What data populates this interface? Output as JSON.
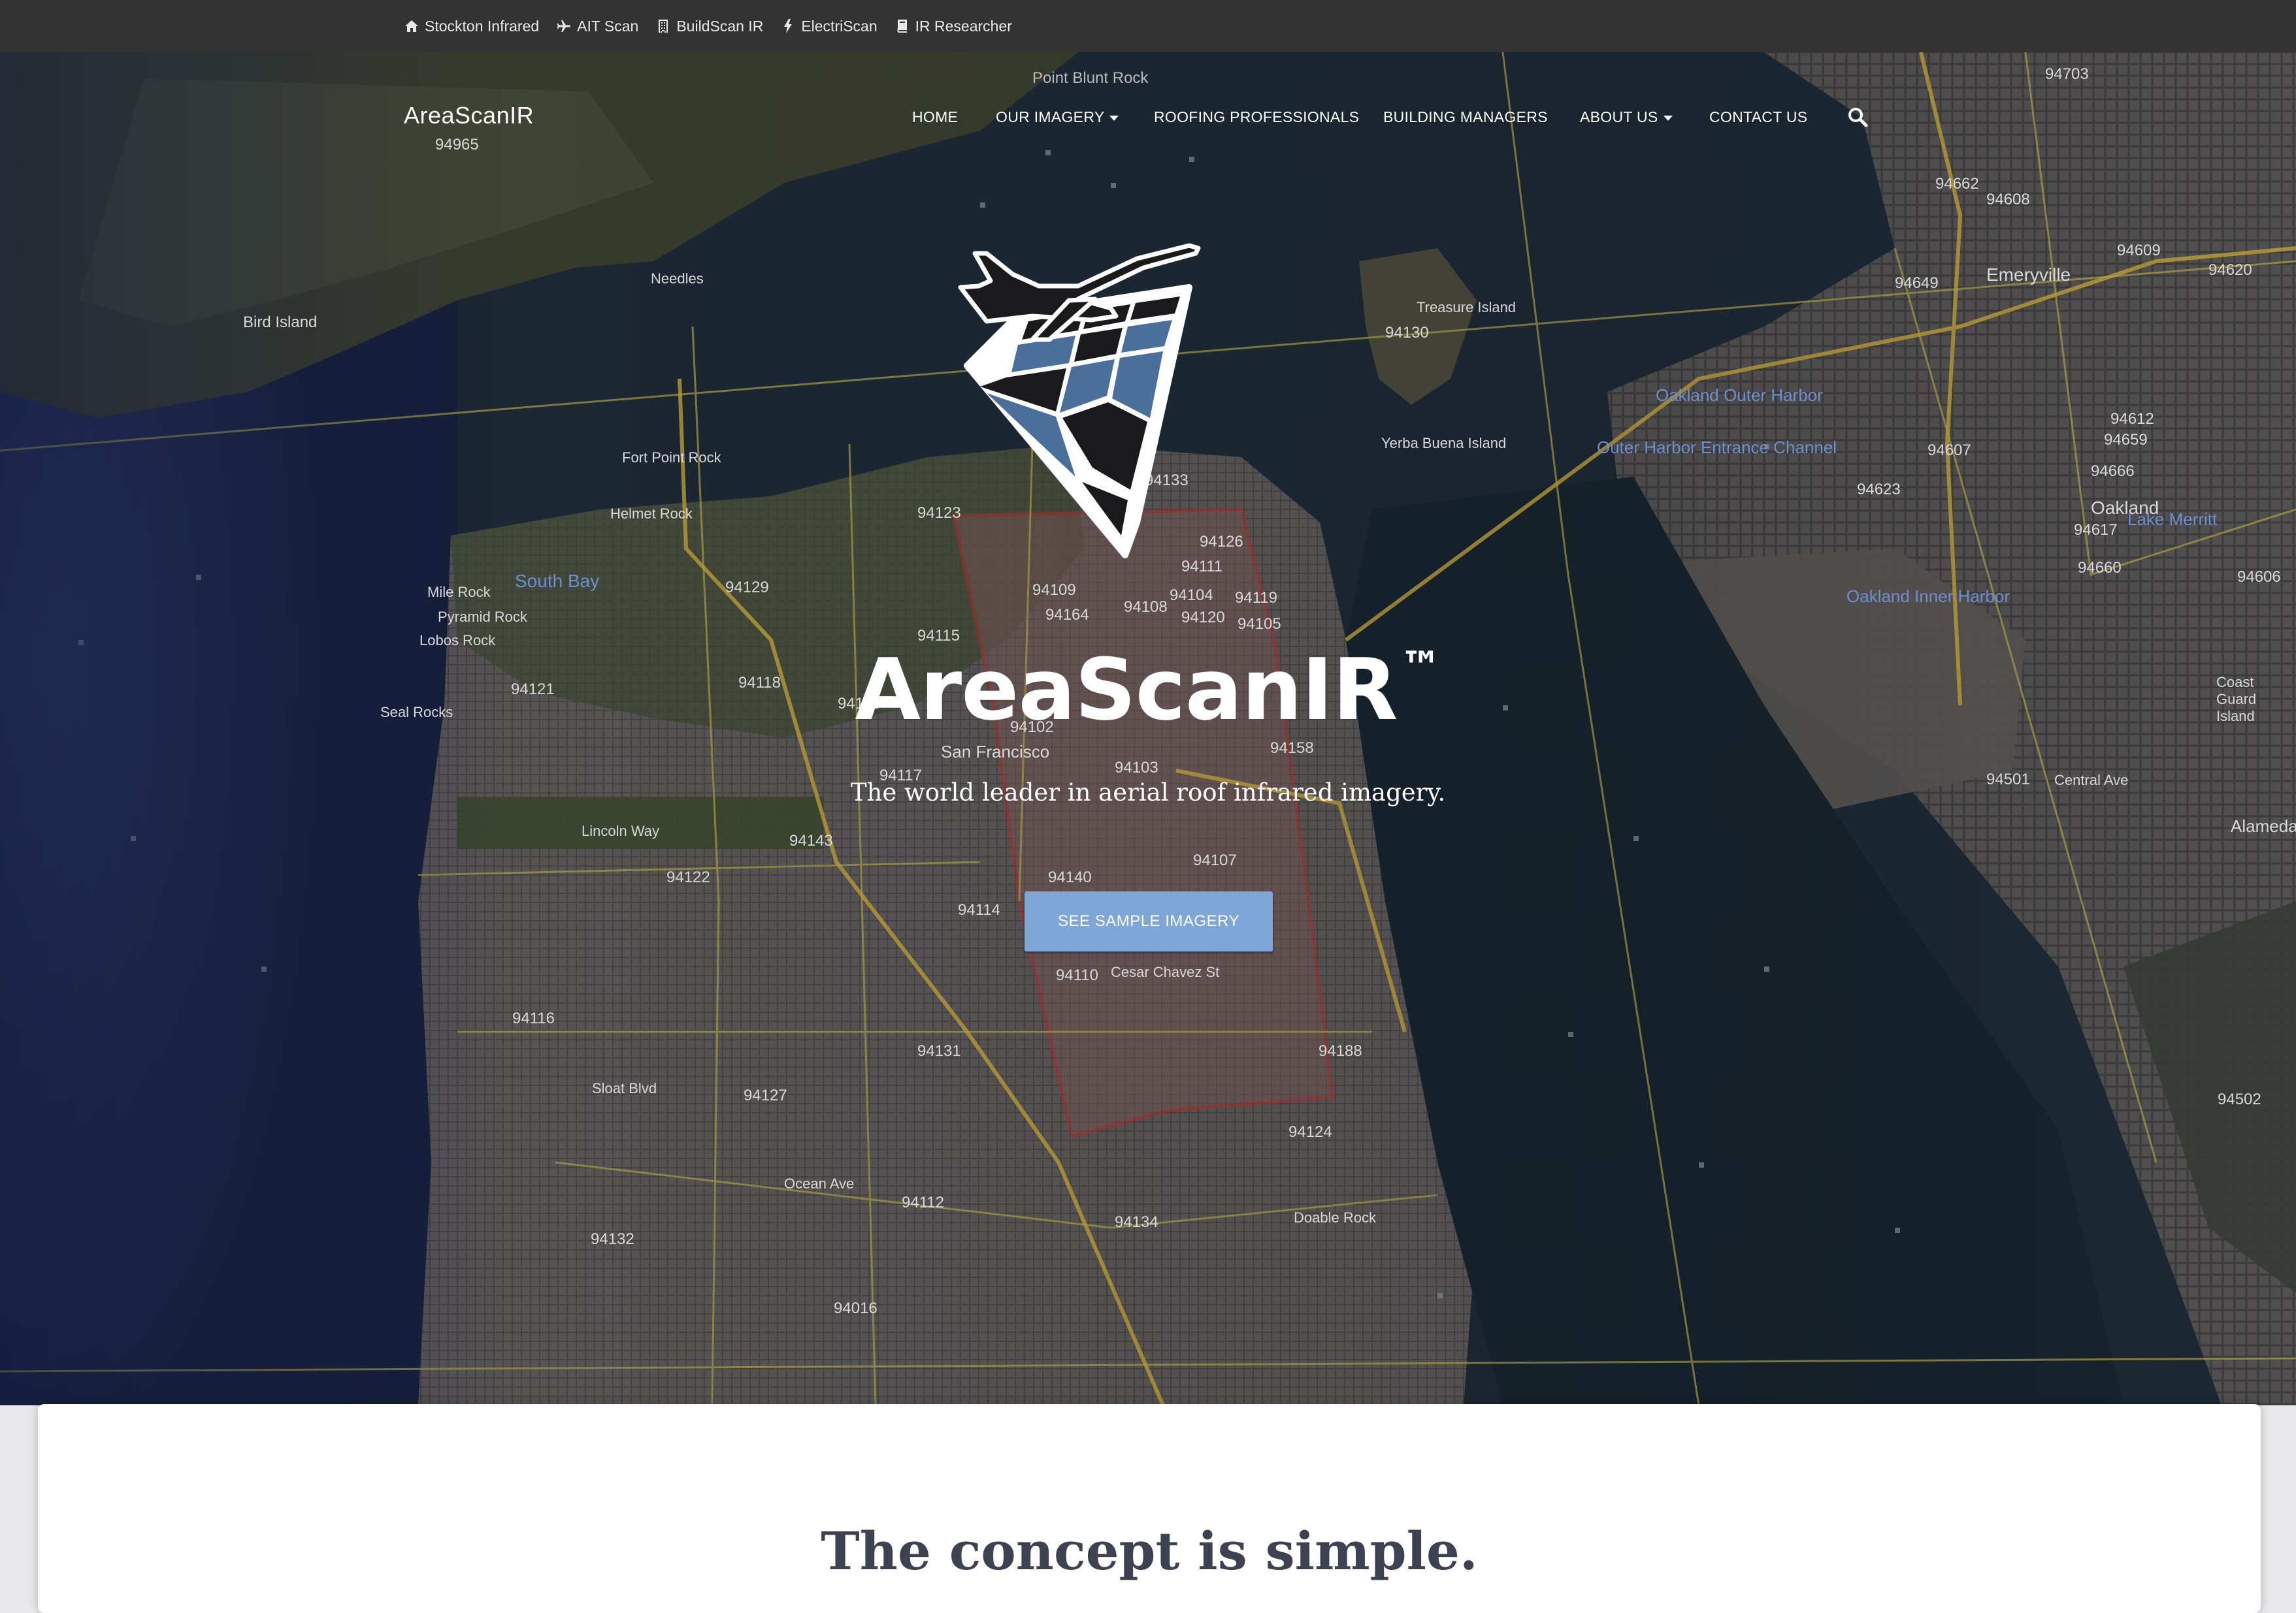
{
  "topbar": {
    "links": [
      {
        "label": "Stockton Infrared",
        "icon": "home-icon"
      },
      {
        "label": "AIT Scan",
        "icon": "plane-icon"
      },
      {
        "label": "BuildScan IR",
        "icon": "building-icon"
      },
      {
        "label": "ElectriScan",
        "icon": "bolt-icon"
      },
      {
        "label": "IR Researcher",
        "icon": "book-icon"
      }
    ]
  },
  "header": {
    "brand": "AreaScanIR",
    "nav": [
      {
        "label": "HOME",
        "dropdown": false
      },
      {
        "label": "OUR IMAGERY",
        "dropdown": true
      },
      {
        "label": "ROOFING PROFESSIONALS",
        "dropdown": false
      },
      {
        "label": "BUILDING MANAGERS",
        "dropdown": false
      },
      {
        "label": "ABOUT US",
        "dropdown": true
      },
      {
        "label": "CONTACT US",
        "dropdown": false
      }
    ],
    "search_icon": "search-icon"
  },
  "hero": {
    "title": "AreaScanIR",
    "trademark": "™",
    "subtitle": "The world leader in aerial roof infrared imagery.",
    "cta_label": "SEE SAMPLE IMAGERY",
    "cta_color": "#7ea7d8",
    "logo_icon": "airplane-scan-logo-icon"
  },
  "map_labels": [
    "Point Blunt Rock",
    "94965",
    "94703",
    "94662",
    "94608",
    "Emeryville",
    "94609",
    "94620",
    "Treasure Island",
    "94130",
    "Yerba Buena Island",
    "Oakland Outer Harbor",
    "Outer Harbor Entrance Channel",
    "94607",
    "94612",
    "94623",
    "Oakland",
    "Lake Merritt",
    "Needles",
    "Bird Island",
    "Fort Point Rock",
    "Helmet Rock",
    "South Bay",
    "Mile Rock",
    "Pyramid Rock",
    "Lobos Rock",
    "Seal Rocks",
    "94123",
    "94129",
    "94121",
    "94118",
    "94115",
    "94109",
    "94108",
    "94104",
    "94111",
    "94133",
    "94119",
    "94164",
    "94120",
    "94105",
    "94126",
    "94102",
    "San Francisco",
    "94103",
    "94158",
    "94117",
    "94159",
    "Lincoln Way",
    "94143",
    "94122",
    "94140",
    "94114",
    "94107",
    "94110",
    "Cesar Chavez St",
    "94116",
    "94131",
    "94127",
    "94188",
    "94124",
    "94112",
    "94134",
    "Doable Rock",
    "94132",
    "94016",
    "Oakland Inner Harbor",
    "94606",
    "Coast Guard Island",
    "94501",
    "Central Ave",
    "Alameda",
    "94502",
    "94649",
    "94659",
    "94666",
    "94617",
    "94660",
    "Sloat Blvd",
    "Ocean Ave"
  ],
  "content": {
    "heading": "The concept is simple."
  }
}
